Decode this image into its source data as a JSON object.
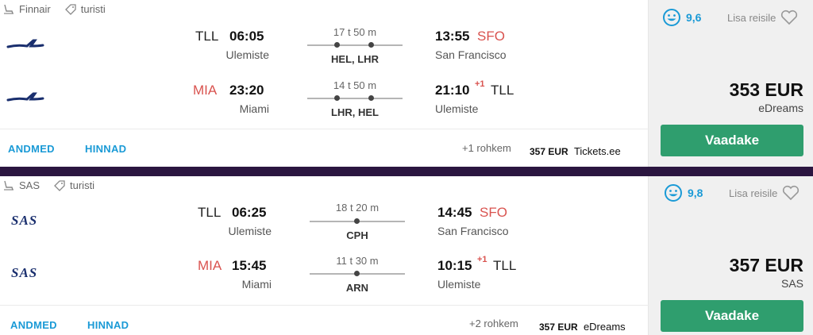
{
  "results": [
    {
      "airline": "Finnair",
      "fare_class": "turisti",
      "legs": [
        {
          "from_code": "TLL",
          "from_code_color": "#222222",
          "depart": "06:05",
          "from_place": "Ulemiste",
          "duration": "17 t 50 m",
          "stops": "HEL, LHR",
          "stop_count": 2,
          "arrive": "13:55",
          "to_code": "SFO",
          "to_code_color": "#d9534f",
          "to_place": "San Francisco",
          "day_offset": ""
        },
        {
          "from_code": "MIA",
          "from_code_color": "#d9534f",
          "depart": "23:20",
          "from_place": "Miami",
          "duration": "14 t 50 m",
          "stops": "LHR, HEL",
          "stop_count": 2,
          "arrive": "21:10",
          "to_code": "TLL",
          "to_code_color": "#222222",
          "to_place": "Ulemiste",
          "day_offset": "+1"
        }
      ],
      "links": {
        "details": "ANDMED",
        "prices": "HINNAD"
      },
      "more": "+1 rohkem",
      "alt_price": "357 EUR",
      "alt_provider": "Tickets.ee",
      "rating": "9,6",
      "save_label": "Lisa reisile",
      "price": "353 EUR",
      "provider": "eDreams",
      "cta": "Vaadake"
    },
    {
      "airline": "SAS",
      "fare_class": "turisti",
      "legs": [
        {
          "from_code": "TLL",
          "from_code_color": "#222222",
          "depart": "06:25",
          "from_place": "Ulemiste",
          "duration": "18 t 20 m",
          "stops": "CPH",
          "stop_count": 1,
          "arrive": "14:45",
          "to_code": "SFO",
          "to_code_color": "#d9534f",
          "to_place": "San Francisco",
          "day_offset": ""
        },
        {
          "from_code": "MIA",
          "from_code_color": "#d9534f",
          "depart": "15:45",
          "from_place": "Miami",
          "duration": "11 t 30 m",
          "stops": "ARN",
          "stop_count": 1,
          "arrive": "10:15",
          "to_code": "TLL",
          "to_code_color": "#222222",
          "to_place": "Ulemiste",
          "day_offset": "+1"
        }
      ],
      "links": {
        "details": "ANDMED",
        "prices": "HINNAD"
      },
      "more": "+2 rohkem",
      "alt_price": "357 EUR",
      "alt_provider": "eDreams",
      "rating": "9,8",
      "save_label": "Lisa reisile",
      "price": "357 EUR",
      "provider": "SAS",
      "cta": "Vaadake"
    }
  ],
  "colors": {
    "accent": "#1a9ad6",
    "cta": "#2f9e6e",
    "divider": "#2b1640",
    "highlight_code": "#d9534f"
  }
}
